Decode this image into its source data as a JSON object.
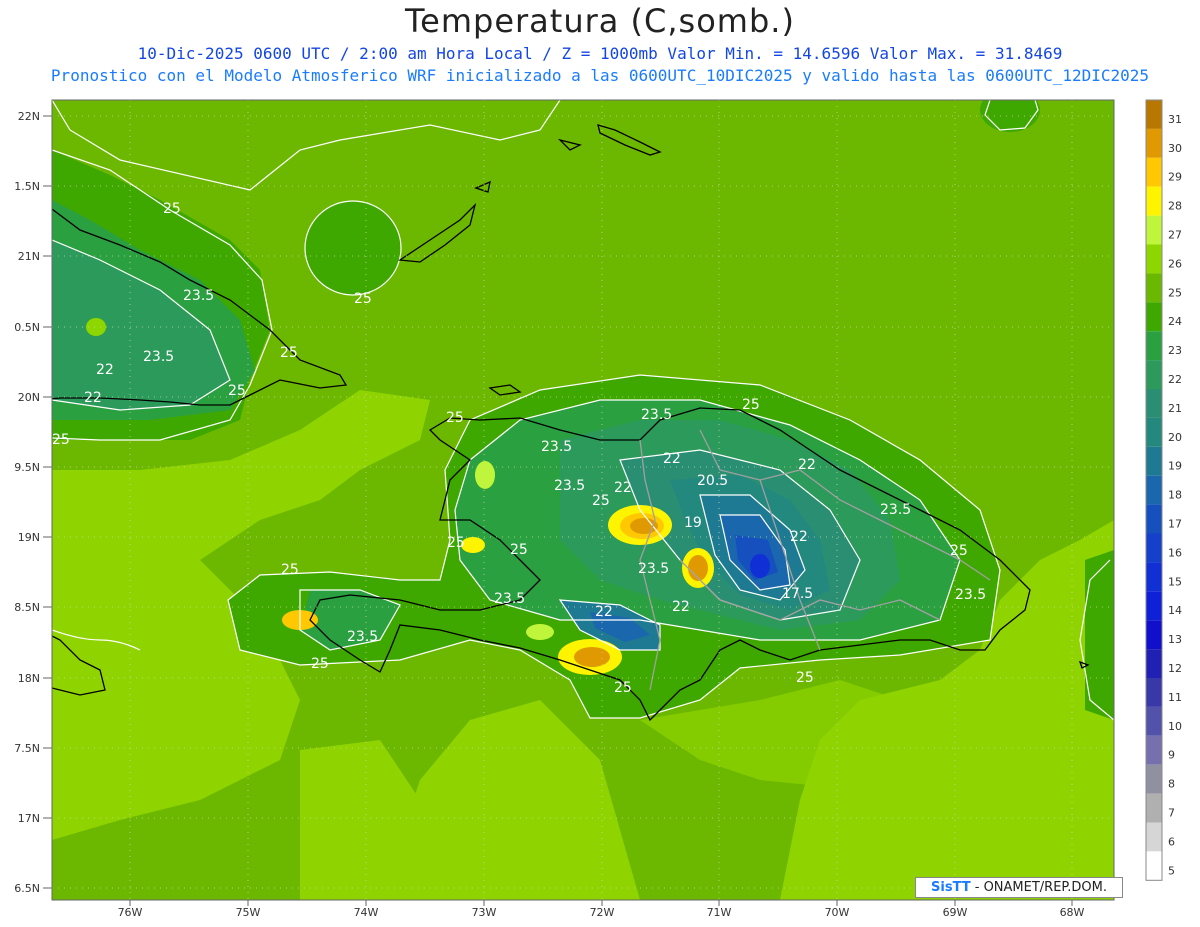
{
  "header": {
    "title": "Temperatura (C,somb.)",
    "subtitle_line1": "10-Dic-2025  0600 UTC / 2:00 am Hora Local / Z = 1000mb   Valor Min. = 14.6596  Valor Max. = 31.8469",
    "subtitle_line2": "Pronostico con el Modelo Atmosferico WRF inicializado a las 0600UTC_10DIC2025 y valido hasta las  0600UTC_12DIC2025"
  },
  "axes": {
    "lat_labels": [
      "22N",
      "1.5N",
      "21N",
      "0.5N",
      "20N",
      "9.5N",
      "19N",
      "8.5N",
      "18N",
      "7.5N",
      "17N",
      "6.5N"
    ],
    "lon_labels": [
      "76W",
      "75W",
      "74W",
      "73W",
      "72W",
      "71W",
      "70W",
      "69W",
      "68W"
    ]
  },
  "contour_labels": {
    "v25": "25",
    "v23_5": "23.5",
    "v22": "22",
    "v20_5": "20.5",
    "v19": "19",
    "v17_5": "17.5"
  },
  "colorbar": {
    "labels": [
      "31",
      "30",
      "29",
      "28",
      "27",
      "26",
      "25",
      "24",
      "23",
      "22",
      "21",
      "20",
      "19",
      "18",
      "17",
      "16",
      "15",
      "14",
      "13",
      "12",
      "11",
      "10",
      "9",
      "8",
      "7",
      "6",
      "5"
    ],
    "colors": [
      "#b87800",
      "#e09a00",
      "#ffc800",
      "#fff400",
      "#bff53a",
      "#8ed600",
      "#6ab800",
      "#3ea800",
      "#2aa040",
      "#2c9a5a",
      "#2a8f72",
      "#23887e",
      "#1e7a92",
      "#1a67ae",
      "#1550be",
      "#1440cc",
      "#1030d6",
      "#0e20d8",
      "#1010cc",
      "#2020b4",
      "#3838a8",
      "#5252aa",
      "#7670ae",
      "#9090a0",
      "#b0b0b0",
      "#d6d6d6",
      "#ffffff"
    ]
  },
  "credit": {
    "logo": "SisTT",
    "text": "- ONAMET/REP.DOM."
  },
  "colors": {
    "bg_light": "#8fd400",
    "bg_mid": "#6cb800",
    "land_green": "#3ea800",
    "contour": "#ffffff",
    "coast": "#000000",
    "border": "#999999"
  }
}
